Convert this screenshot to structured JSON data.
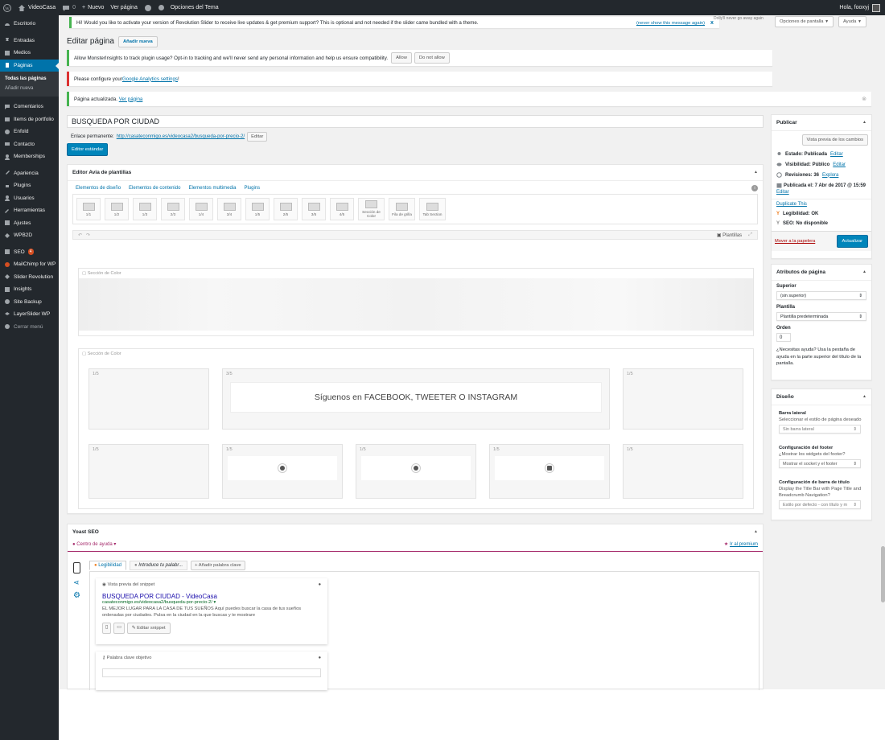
{
  "adminbar": {
    "site": "VideoCasa",
    "comments": "0",
    "new": "Nuevo",
    "view_page": "Ver página",
    "theme_options": "Opciones del Tema",
    "greeting": "Hola, fooxyj"
  },
  "sidebar": {
    "items": [
      "Escritorio",
      "Entradas",
      "Medios",
      "Páginas",
      "Comentarios",
      "Items de portfolio",
      "Enfold",
      "Contacto",
      "Memberships",
      "Apariencia",
      "Plugins",
      "Usuarios",
      "Herramientas",
      "Ajustes",
      "WPB2D",
      "SEO",
      "MailChimp for WP",
      "Slider Revolution",
      "Insights",
      "Site Backup",
      "LayerSlider WP",
      "Cerrar menú"
    ],
    "sub": [
      "Todas las páginas",
      "Añadir nueva"
    ],
    "seo_badge": "4"
  },
  "top": {
    "revslider_notice": "Hi! Would you like to activate your version of Revolution Slider to receive live updates & get premium support? This is optional and not needed if the slider came bundled with a theme.",
    "never_show": "(never show this message again)",
    "dolly": "Dolly'll never go away again",
    "screen_options": "Opciones de pantalla",
    "help": "Ayuda"
  },
  "page": {
    "title": "Editar página",
    "add_new": "Añadir nueva"
  },
  "notices": {
    "monster": "Allow MonsterInsights to track plugin usage? Opt-in to tracking and we'll never send any personal information and help us ensure compatibility.",
    "allow": "Allow",
    "deny": "Do not allow",
    "ga_prefix": "Please configure your ",
    "ga_link": "Google Analytics settings",
    "ga_suffix": "!",
    "updated": "Página actualizada.",
    "view": "Ver página"
  },
  "editor": {
    "post_title": "BUSQUEDA POR CIUDAD",
    "permalink_label": "Enlace permanente:",
    "permalink_url": "http://casateconmigo.es/videocasa2/busqueda-por-precio-2/",
    "edit": "Editar",
    "std_editor": "Editor estándar"
  },
  "avia": {
    "title": "Editor Avia de plantillas",
    "tabs": [
      "Elementos de diseño",
      "Elementos de contenido",
      "Elementos multimedia",
      "Plugins"
    ],
    "elements": [
      "1/1",
      "1/2",
      "1/3",
      "2/3",
      "1/4",
      "3/4",
      "1/5",
      "2/5",
      "3/5",
      "4/5",
      "Sección de Color",
      "Fila de grilla",
      "Tab Section"
    ],
    "templates": "Plantillas",
    "section1": "Sección de Color",
    "section2": "Sección de Color",
    "row1": [
      "1/5",
      "3/5",
      "1/5"
    ],
    "row2": [
      "1/5",
      "1/5",
      "1/5",
      "1/5",
      "1/5"
    ],
    "follow": "Síguenos en FACEBOOK, TWEETER O INSTAGRAM"
  },
  "publish": {
    "title": "Publicar",
    "preview": "Vista previa de los cambios",
    "status": "Estado: Publicada",
    "visibility": "Visibilidad: Público",
    "revisions": "Revisiones: 36",
    "explore": "Explora",
    "published": "Publicada el: 7 Abr de 2017 @ 15:59",
    "edit": "Editar",
    "duplicate": "Duplicate This",
    "readability": "Legibilidad: OK",
    "seo": "SEO: No disponible",
    "trash": "Mover a la papelera",
    "update": "Actualizar"
  },
  "attrs": {
    "title": "Atributos de página",
    "parent_label": "Superior",
    "parent_value": "(sin superior)",
    "template_label": "Plantilla",
    "template_value": "Plantilla predeterminada",
    "order_label": "Orden",
    "order_value": "0",
    "help": "¿Necesitas ayuda? Usa la pestaña de ayuda en la parte superior del título de la pantalla."
  },
  "design": {
    "title": "Diseño",
    "sidebar_label": "Barra lateral",
    "sidebar_desc": "Seleccionar el estilo de página deseado",
    "sidebar_value": "Sin barra lateral",
    "footer_label": "Configuración del footer",
    "footer_desc": "¿Mostrar los widgets del footer?",
    "footer_value": "Mostrar el socket y el footer",
    "titlebar_label": "Configuración de barra de título",
    "titlebar_desc": "Display the Title Bar with Page Title and Breadcrumb Navigation?",
    "titlebar_value": "Estilo por defecto - con título y m"
  },
  "yoast": {
    "title": "Yoast SEO",
    "help_center": "Centro de ayuda",
    "premium": "Ir al premium",
    "tab_readability": "Legibilidad",
    "tab_keyword": "Introduce tu palabr...",
    "add_keyword": "+ Añadir palabra clave",
    "snippet_label": "Vista previa del snippet",
    "snippet_title": "BUSQUEDA POR CIUDAD - VideoCasa",
    "snippet_url": "casateconmigo.es/videocasa2/busqueda-por-precio-2/",
    "snippet_desc": "EL MEJOR LUGAR PARA LA CASA DE TUS SUEÑOS Aquí puedes buscar la casa de tus sueños ordenadas por ciudades. Pulsa en la ciudad en la que buscas y te mostrare",
    "edit_snippet": "Editar snippet",
    "keyword_label": "Palabra clave objetivo"
  },
  "colors": {
    "accent": "#0073aa",
    "adminbar": "#23282d",
    "active_green": "#46b450",
    "error_red": "#dc3232"
  }
}
